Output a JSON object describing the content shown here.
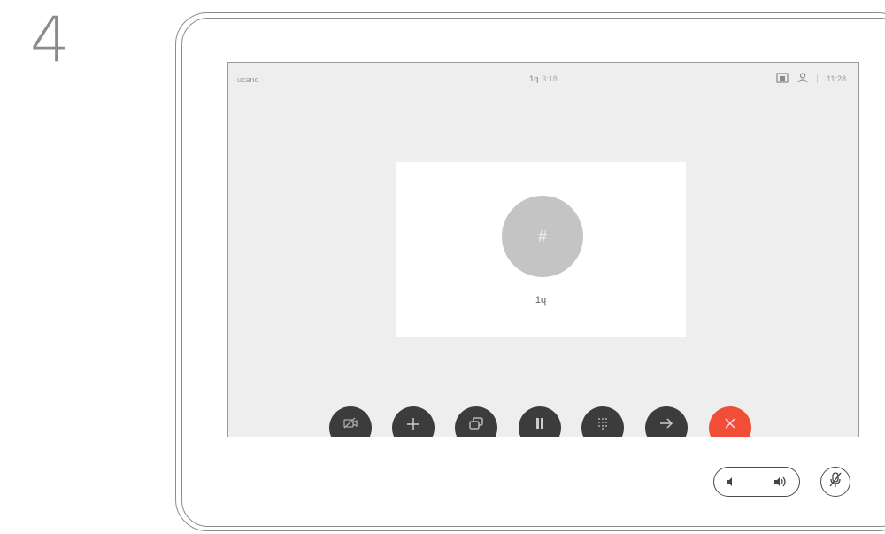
{
  "step_number": "4",
  "status_bar": {
    "left_label": "ucano",
    "center_name": "1q",
    "center_duration": "3:18",
    "time": "11:28"
  },
  "call_card": {
    "avatar_symbol": "#",
    "name": "1q"
  },
  "controls": [
    {
      "icon": "camera-off-icon"
    },
    {
      "icon": "add-icon"
    },
    {
      "icon": "share-screen-icon"
    },
    {
      "icon": "pause-icon"
    },
    {
      "icon": "keypad-icon"
    },
    {
      "icon": "transfer-arrow-icon"
    },
    {
      "icon": "end-call-icon",
      "color": "#f04e37"
    }
  ],
  "colors": {
    "end_call": "#f04e37",
    "control_button": "#3c3c3c",
    "avatar": "#c4c4c4",
    "screen_bg": "#eeeeee"
  }
}
